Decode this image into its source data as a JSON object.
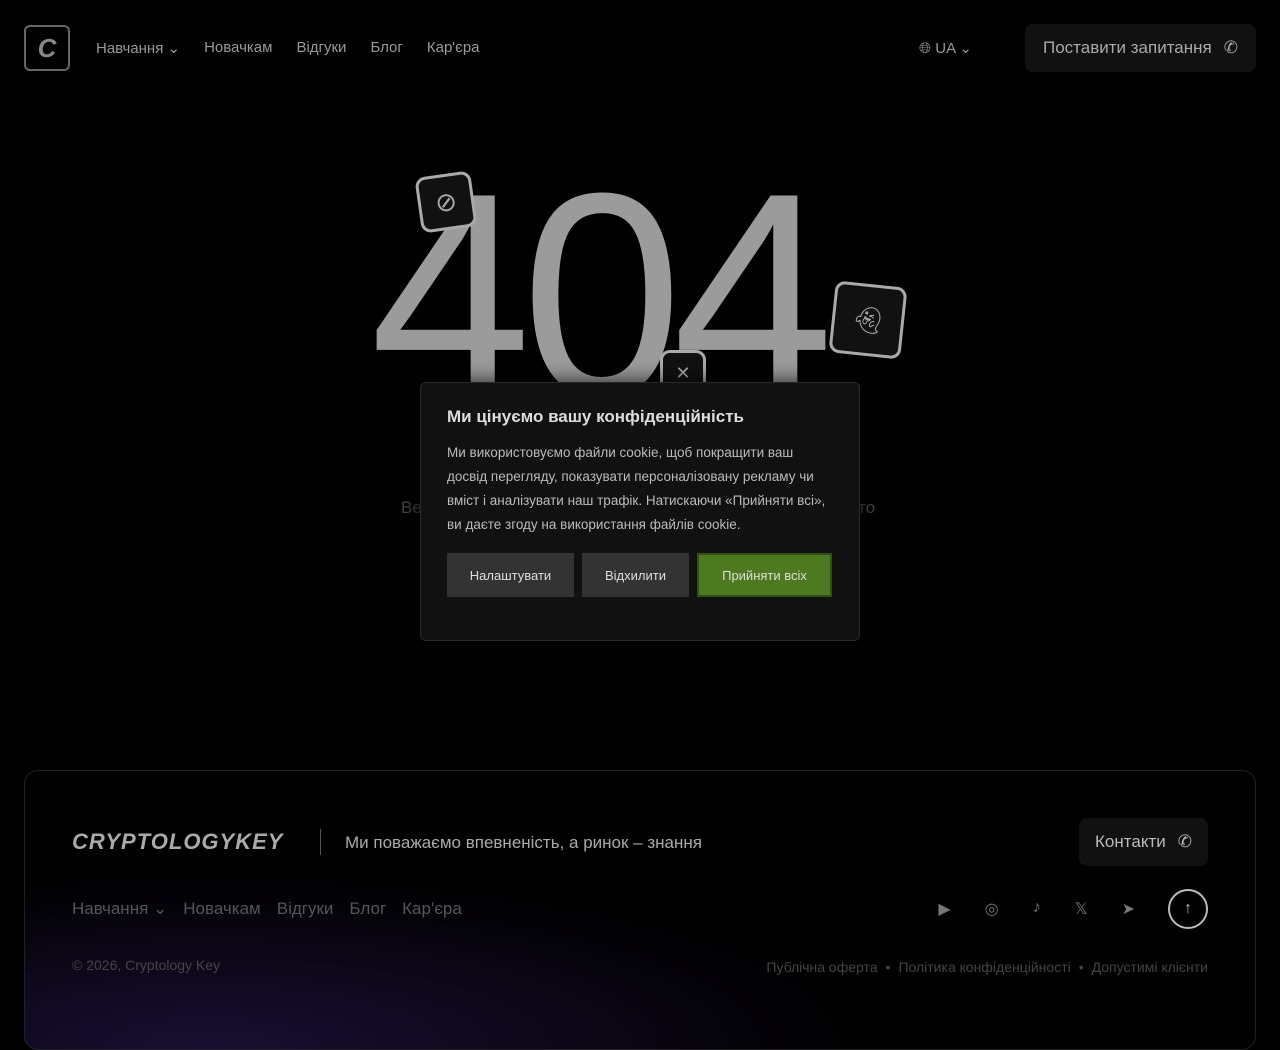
{
  "header": {
    "logo": "C",
    "nav": [
      "Навчання",
      "Новачкам",
      "Відгуки",
      "Блог",
      "Кар'єра"
    ],
    "lang": "UA",
    "ask_button": "Поставити запитання"
  },
  "main": {
    "code": "404",
    "fragment_left": "Ве",
    "fragment_right": "то"
  },
  "cookie": {
    "title": "Ми цінуємо вашу конфіденційність",
    "body": "Ми використовуємо файли cookie, щоб покращити ваш досвід перегляду, показувати персоналізовану рекламу чи вміст і аналізувати наш трафік. Натискаючи «Прийняти всі», ви даєте згоду на використання файлів cookie.",
    "customize": "Налаштувати",
    "reject": "Відхилити",
    "accept": "Прийняти всіх"
  },
  "footer": {
    "brand": "CRYPTOLOGYKEY",
    "slogan": "Ми поважаємо впевненість, а ринок – знання",
    "contact": "Контакти",
    "nav": [
      "Навчання",
      "Новачкам",
      "Відгуки",
      "Блог",
      "Кар'єра"
    ],
    "copyright": "© 2026, Cryptology Key",
    "legal": [
      "Публічна оферта",
      "Політика конфіденційності",
      "Допустимі клієнти"
    ]
  }
}
